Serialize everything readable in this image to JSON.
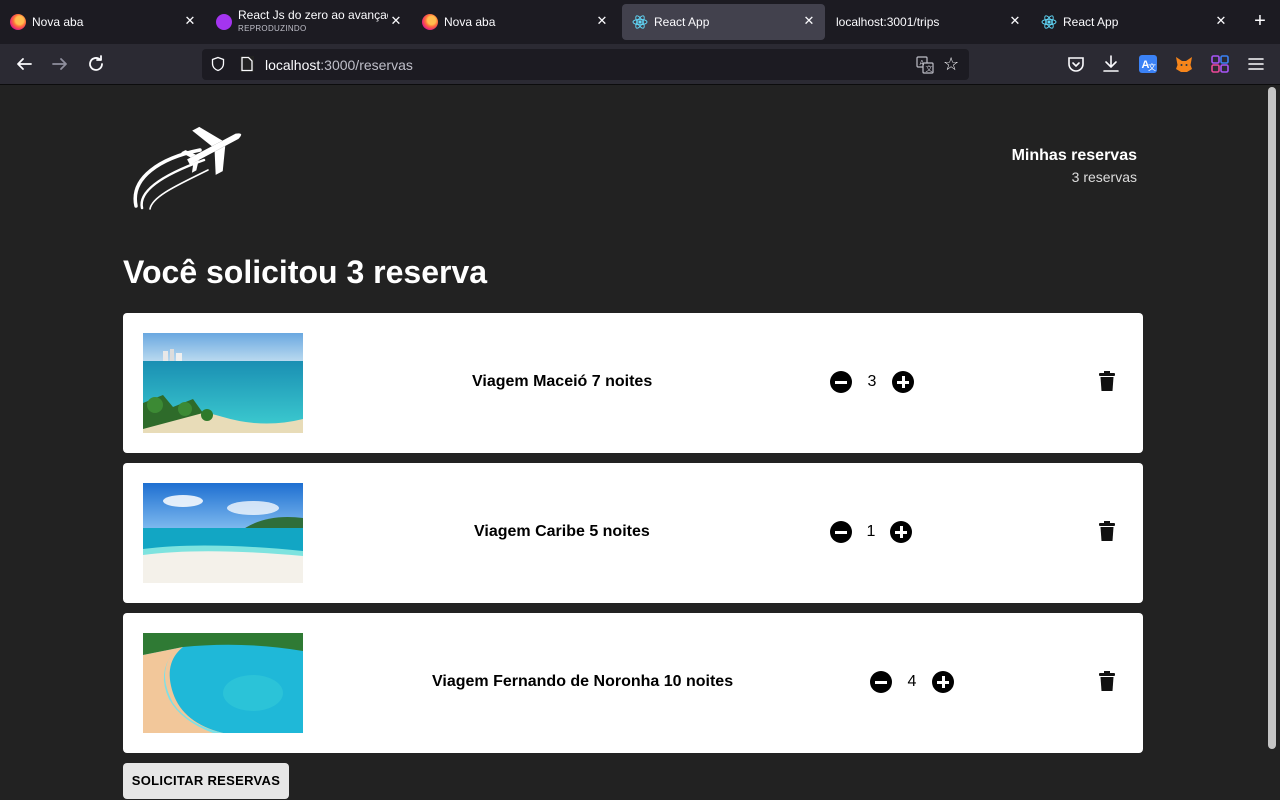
{
  "browser": {
    "tabs": [
      {
        "title": "Nova aba",
        "subtitle": "",
        "icon": "firefox-icon",
        "active": false
      },
      {
        "title": "React Js do zero ao avançado",
        "subtitle": "REPRODUZINDO",
        "icon": "udemy-icon",
        "active": false
      },
      {
        "title": "Nova aba",
        "subtitle": "",
        "icon": "firefox-icon",
        "active": false
      },
      {
        "title": "React App",
        "subtitle": "",
        "icon": "react-icon",
        "active": true
      },
      {
        "title": "localhost:3001/trips",
        "subtitle": "",
        "icon": "",
        "active": false
      },
      {
        "title": "React App",
        "subtitle": "",
        "icon": "react-icon",
        "active": false
      }
    ],
    "url_host": "localhost",
    "url_rest": ":3000/reservas"
  },
  "header": {
    "cart_title": "Minhas reservas",
    "cart_count": "3 reservas"
  },
  "main": {
    "heading": "Você solicitou 3 reserva",
    "reservations": [
      {
        "name": "Viagem Maceió 7 noites",
        "amount": "3"
      },
      {
        "name": "Viagem Caribe 5 noites",
        "amount": "1"
      },
      {
        "name": "Viagem Fernando de Noronha 10 noites",
        "amount": "4"
      }
    ],
    "submit_label": "SOLICITAR RESERVAS"
  },
  "colors": {
    "page_bg": "#222222",
    "card_bg": "#ffffff",
    "browser_bg": "#1c1b22"
  }
}
